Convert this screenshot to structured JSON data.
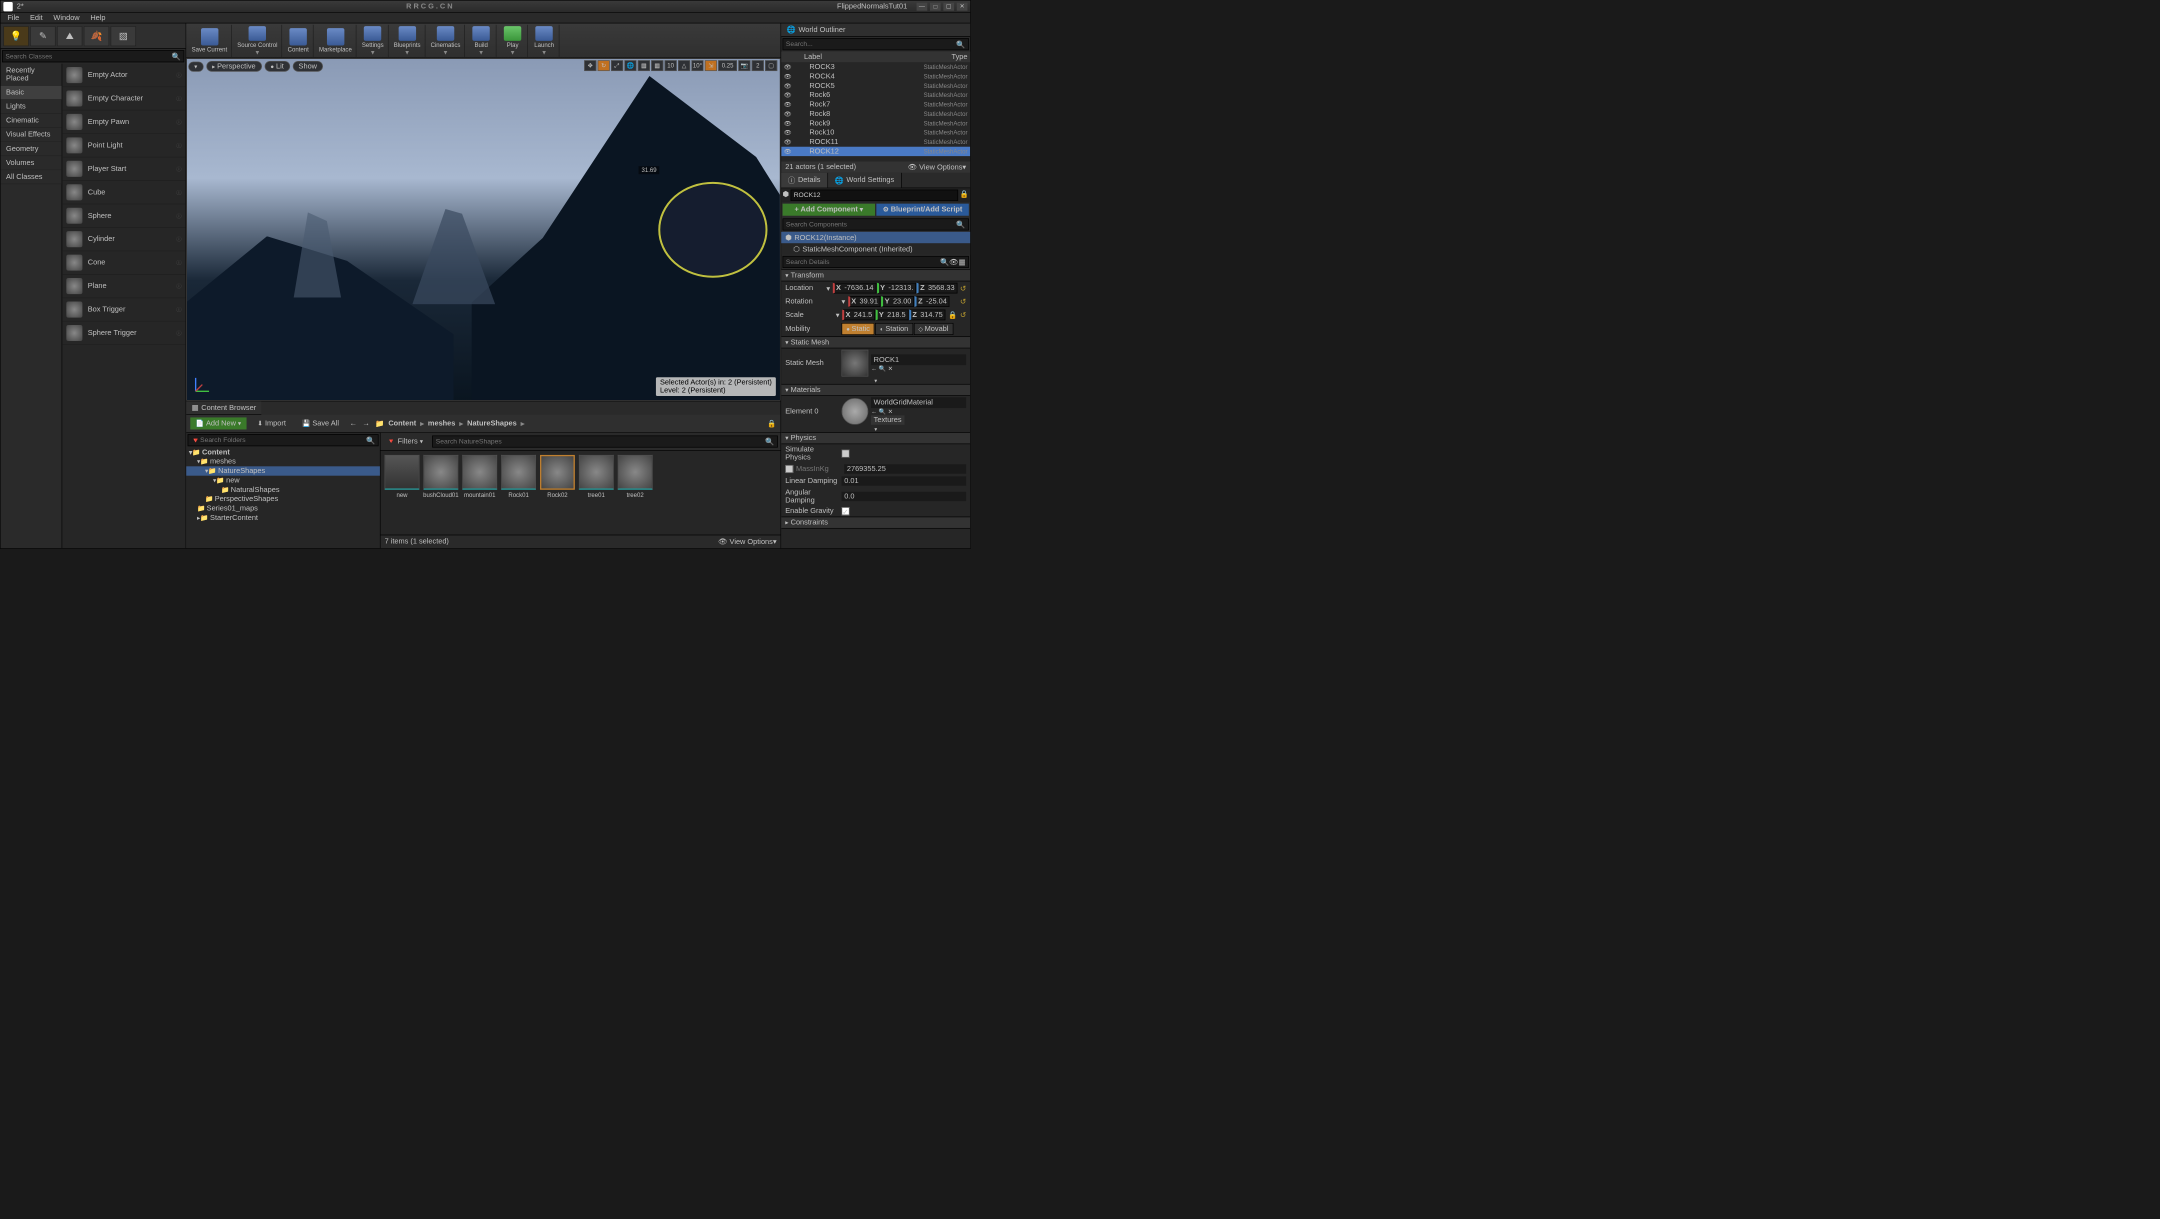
{
  "titlebar": {
    "level": "2*",
    "watermark": "RRCG.CN",
    "project": "FlippedNormalsTut01"
  },
  "menubar": [
    "File",
    "Edit",
    "Window",
    "Help"
  ],
  "modes": {
    "search_placeholder": "Search Classes"
  },
  "categories": [
    "Recently Placed",
    "Basic",
    "Lights",
    "Cinematic",
    "Visual Effects",
    "Geometry",
    "Volumes",
    "All Classes"
  ],
  "actors": [
    "Empty Actor",
    "Empty Character",
    "Empty Pawn",
    "Point Light",
    "Player Start",
    "Cube",
    "Sphere",
    "Cylinder",
    "Cone",
    "Plane",
    "Box Trigger",
    "Sphere Trigger"
  ],
  "toolbar": [
    {
      "label": "Save Current"
    },
    {
      "label": "Source Control"
    },
    {
      "label": "Content"
    },
    {
      "label": "Marketplace"
    },
    {
      "label": "Settings"
    },
    {
      "label": "Blueprints"
    },
    {
      "label": "Cinematics"
    },
    {
      "label": "Build"
    },
    {
      "label": "Play"
    },
    {
      "label": "Launch"
    }
  ],
  "viewport": {
    "perspective": "Perspective",
    "lit": "Lit",
    "show": "Show",
    "grid": "10",
    "angle": "10°",
    "scale": "0.25",
    "cam": "2",
    "measurement": "31.69",
    "status1": "Selected Actor(s) in:  2 (Persistent)",
    "status2": "Level:  2 (Persistent)"
  },
  "outliner": {
    "title": "World Outliner",
    "search_placeholder": "Search...",
    "col1": "Label",
    "col2": "Type",
    "items": [
      {
        "label": "ROCK3",
        "type": "StaticMeshActor"
      },
      {
        "label": "ROCK4",
        "type": "StaticMeshActor"
      },
      {
        "label": "ROCK5",
        "type": "StaticMeshActor"
      },
      {
        "label": "Rock6",
        "type": "StaticMeshActor"
      },
      {
        "label": "Rock7",
        "type": "StaticMeshActor"
      },
      {
        "label": "Rock8",
        "type": "StaticMeshActor"
      },
      {
        "label": "Rock9",
        "type": "StaticMeshActor"
      },
      {
        "label": "Rock10",
        "type": "StaticMeshActor"
      },
      {
        "label": "ROCK11",
        "type": "StaticMeshActor"
      },
      {
        "label": "ROCK12",
        "type": "StaticMeshActor"
      }
    ],
    "footer_left": "21 actors (1 selected)",
    "footer_right": "View Options"
  },
  "details": {
    "tab1": "Details",
    "tab2": "World Settings",
    "name": "ROCK12",
    "add_component": "+ Add Component",
    "blueprint": "Blueprint/Add Script",
    "search_components": "Search Components",
    "comp_root": "ROCK12(Instance)",
    "comp_child": "StaticMeshComponent (Inherited)",
    "search_details": "Search Details",
    "sections": {
      "transform": "Transform",
      "static_mesh": "Static Mesh",
      "materials": "Materials",
      "physics": "Physics",
      "constraints": "Constraints"
    },
    "transform": {
      "loc_label": "Location",
      "rot_label": "Rotation",
      "scale_label": "Scale",
      "mob_label": "Mobility",
      "loc": {
        "x": "-7636.14",
        "y": "-12313.",
        "z": "3568.33"
      },
      "rot": {
        "x": "39.91",
        "y": "23.00",
        "z": "-25.04"
      },
      "scale": {
        "x": "241.5",
        "y": "218.5",
        "z": "314.75"
      },
      "mob": [
        "Static",
        "Station",
        "Movabl"
      ]
    },
    "static_mesh": {
      "label": "Static Mesh",
      "value": "ROCK1"
    },
    "materials": {
      "element": "Element 0",
      "value": "WorldGridMaterial",
      "textures": "Textures"
    },
    "physics": {
      "sim": "Simulate Physics",
      "mass": "MassInKg",
      "mass_val": "2769355.25",
      "lin": "Linear Damping",
      "lin_val": "0.01",
      "ang": "Angular Damping",
      "ang_val": "0.0",
      "grav": "Enable Gravity"
    }
  },
  "content_browser": {
    "title": "Content Browser",
    "add_new": "Add New",
    "import": "Import",
    "save_all": "Save All",
    "breadcrumb": [
      "Content",
      "meshes",
      "NatureShapes"
    ],
    "search_folders": "Search Folders",
    "filters": "Filters",
    "search_assets": "Search NatureShapes",
    "tree": [
      "Content",
      "meshes",
      "NatureShapes",
      "new",
      "NaturalShapes",
      "PerspectiveShapes",
      "Series01_maps",
      "StarterContent"
    ],
    "assets": [
      "new",
      "bushCloud01",
      "mountain01",
      "Rock01",
      "Rock02",
      "tree01",
      "tree02"
    ],
    "footer_left": "7 items (1 selected)",
    "footer_right": "View Options"
  }
}
